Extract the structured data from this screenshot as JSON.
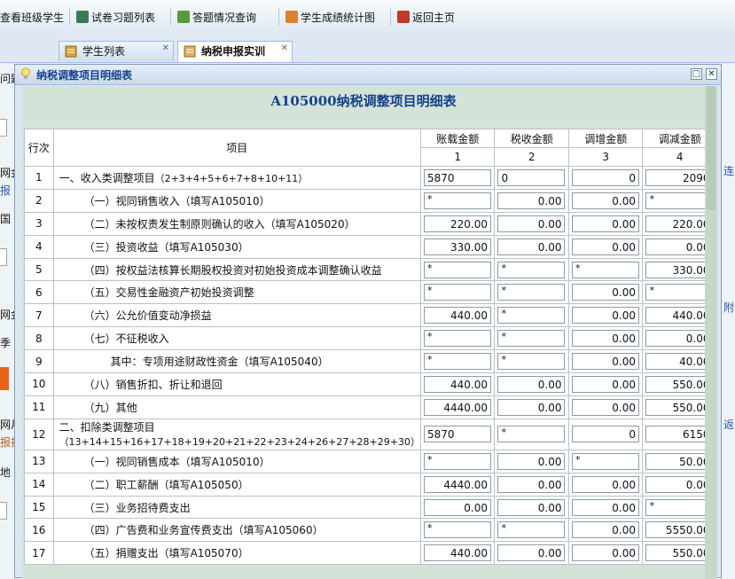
{
  "toolbar": {
    "items": [
      {
        "label": "查看班级学生",
        "icon": "class-students-icon",
        "color": "#4a78b8"
      },
      {
        "label": "试卷习题列表",
        "icon": "exam-list-icon",
        "color": "#3b7a57"
      },
      {
        "label": "答题情况查询",
        "icon": "answer-query-icon",
        "color": "#5a9a3a"
      },
      {
        "label": "学生成绩统计图",
        "icon": "pie-chart-icon",
        "color": "#d9822b"
      },
      {
        "label": "返回主页",
        "icon": "home-icon",
        "color": "#c03a2b"
      }
    ]
  },
  "tabs": [
    {
      "label": "学生列表",
      "active": false
    },
    {
      "label": "纳税申报实训",
      "active": true
    }
  ],
  "background": {
    "left_text": [
      "问题",
      "网金",
      "报",
      "国",
      "网金",
      "季",
      "网月",
      "报折",
      "地"
    ],
    "right_text": [
      "连",
      "附",
      "返"
    ]
  },
  "dialog": {
    "title": "纳税调整项目明细表",
    "form_title": "A105000纳税调整项目明细表",
    "headers": {
      "row_no": "行次",
      "item": "项目",
      "cols": [
        "账载金额",
        "税收金额",
        "调增金额",
        "调减金额"
      ],
      "col_nums": [
        "1",
        "2",
        "3",
        "4"
      ]
    },
    "rows": [
      {
        "no": "1",
        "item": "一、收入类调整项目",
        "note": "（2+3+4+5+6+7+8+10+11）",
        "indent": 0,
        "v": [
          "5870",
          "0",
          "0",
          "2090"
        ],
        "align": [
          "l",
          "l",
          "r",
          "r"
        ]
      },
      {
        "no": "2",
        "item": "（一）视同销售收入（填写A105010）",
        "note": "",
        "indent": 1,
        "v": [
          "*",
          "0.00",
          "0.00",
          "*"
        ]
      },
      {
        "no": "3",
        "item": "（二）未按权责发生制原则确认的收入（填写A105020）",
        "note": "",
        "indent": 1,
        "v": [
          "220.00",
          "0.00",
          "0.00",
          "220.00"
        ]
      },
      {
        "no": "4",
        "item": "（三）投资收益（填写A105030）",
        "note": "",
        "indent": 1,
        "v": [
          "330.00",
          "0.00",
          "0.00",
          "0.00"
        ]
      },
      {
        "no": "5",
        "item": "（四）按权益法核算长期股权投资对初始投资成本调整确认收益",
        "note": "",
        "indent": 1,
        "v": [
          "*",
          "*",
          "*",
          "330.00"
        ]
      },
      {
        "no": "6",
        "item": "（五）交易性金融资产初始投资调整",
        "note": "",
        "indent": 1,
        "v": [
          "*",
          "*",
          "0.00",
          "*"
        ]
      },
      {
        "no": "7",
        "item": "（六）公允价值变动净损益",
        "note": "",
        "indent": 1,
        "v": [
          "440.00",
          "*",
          "0.00",
          "440.00"
        ]
      },
      {
        "no": "8",
        "item": "（七）不征税收入",
        "note": "",
        "indent": 1,
        "v": [
          "*",
          "*",
          "0.00",
          "0.00"
        ]
      },
      {
        "no": "9",
        "item": "其中：专项用途财政性资金（填写A105040）",
        "note": "",
        "indent": 2,
        "v": [
          "*",
          "*",
          "0.00",
          "40.00"
        ]
      },
      {
        "no": "10",
        "item": "（八）销售折扣、折让和退回",
        "note": "",
        "indent": 1,
        "v": [
          "440.00",
          "0.00",
          "0.00",
          "550.00"
        ]
      },
      {
        "no": "11",
        "item": "（九）其他",
        "note": "",
        "indent": 1,
        "v": [
          "4440.00",
          "0.00",
          "0.00",
          "550.00"
        ]
      },
      {
        "no": "12",
        "item": "二、扣除类调整项目",
        "note": "（13+14+15+16+17+18+19+20+21+22+23+24+26+27+28+29+30）",
        "indent": 0,
        "twoline": true,
        "v": [
          "5870",
          "*",
          "0",
          "6150"
        ],
        "align": [
          "l",
          "l",
          "r",
          "r"
        ]
      },
      {
        "no": "13",
        "item": "（一）视同销售成本（填写A105010）",
        "note": "",
        "indent": 1,
        "v": [
          "*",
          "0.00",
          "*",
          "50.00"
        ]
      },
      {
        "no": "14",
        "item": "（二）职工薪酬（填写A105050）",
        "note": "",
        "indent": 1,
        "v": [
          "4440.00",
          "0.00",
          "0.00",
          "0.00"
        ]
      },
      {
        "no": "15",
        "item": "（三）业务招待费支出",
        "note": "",
        "indent": 1,
        "v": [
          "0.00",
          "0.00",
          "0.00",
          "*"
        ]
      },
      {
        "no": "16",
        "item": "（四）广告费和业务宣传费支出（填写A105060）",
        "note": "",
        "indent": 1,
        "v": [
          "*",
          "*",
          "0.00",
          "5550.00"
        ]
      },
      {
        "no": "17",
        "item": "（五）捐赠支出（填写A105070）",
        "note": "",
        "indent": 1,
        "v": [
          "440.00",
          "0.00",
          "0.00",
          "550.00"
        ]
      }
    ]
  }
}
